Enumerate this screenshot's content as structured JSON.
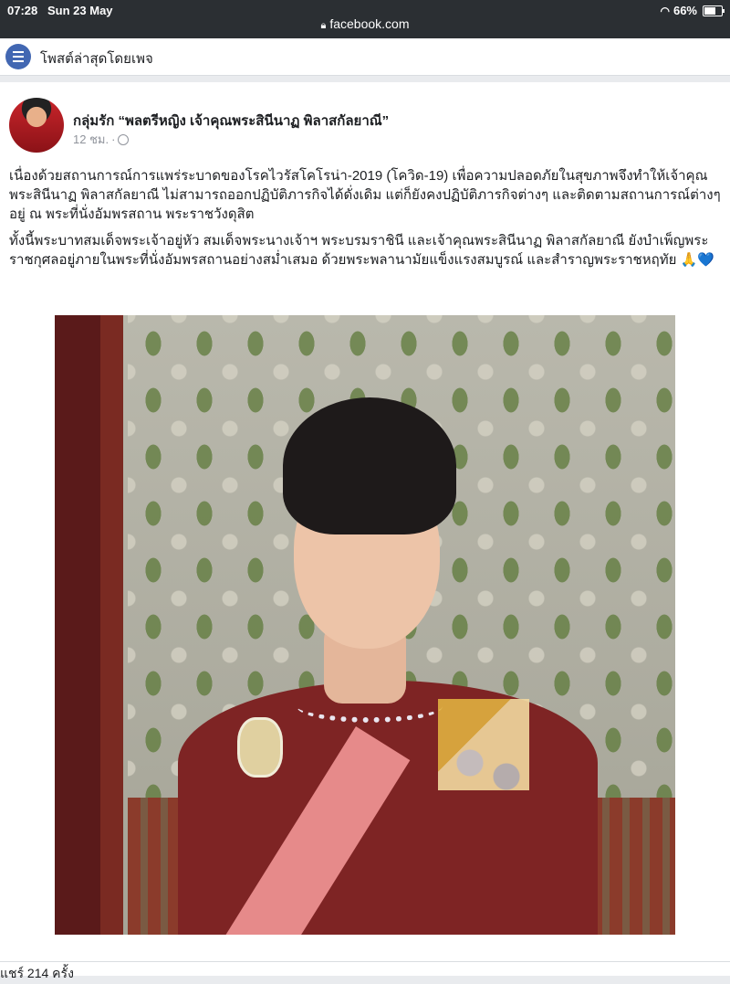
{
  "status": {
    "time": "07:28",
    "date": "Sun 23 May",
    "url": "facebook.com",
    "battery": "66%",
    "battery_level": 0.66
  },
  "pagebar": {
    "icon": "news-feed-icon",
    "title": "โพสต์ล่าสุดโดยเพจ"
  },
  "post": {
    "author": "กลุ่มรัก “พลตรีหญิง เจ้าคุณพระสินีนาฏ พิลาสกัลยาณี”",
    "time": "12 ชม.",
    "separator": "·",
    "paragraph1": "เนื่องด้วยสถานการณ์การแพร่ระบาดของโรคไวรัสโคโรน่า-2019 (โควิด-19) เพื่อความปลอดภัยในสุขภาพจึงทำให้เจ้าคุณพระสินีนาฏ พิลาสกัลยาณี ไม่สามารถออกปฏิบัติภารกิจได้ดั่งเดิม แต่ก็ยังคงปฏิบัติภารกิจต่างๆ และติดตามสถานการณ์ต่างๆ อยู่ ณ พระที่นั่งอัมพรสถาน พระราชวังดุสิต",
    "paragraph2": "ทั้งนี้พระบาทสมเด็จพระเจ้าอยู่หัว สมเด็จพระนางเจ้าฯ พระบรมราชินี และเจ้าคุณพระสินีนาฏ พิลาสกัลยาณี ยังบำเพ็ญพระราชกุศลอยู่ภายในพระที่นั่งอัมพรสถานอย่างสม่ำเสมอ ด้วยพระพลานามัยแข็งแรงสมบูรณ์ และสำราญพระราชหฤทัย",
    "emoji": "🙏",
    "heart": "💙"
  },
  "footer": {
    "text": "แชร์ 214 ครั้ง"
  }
}
